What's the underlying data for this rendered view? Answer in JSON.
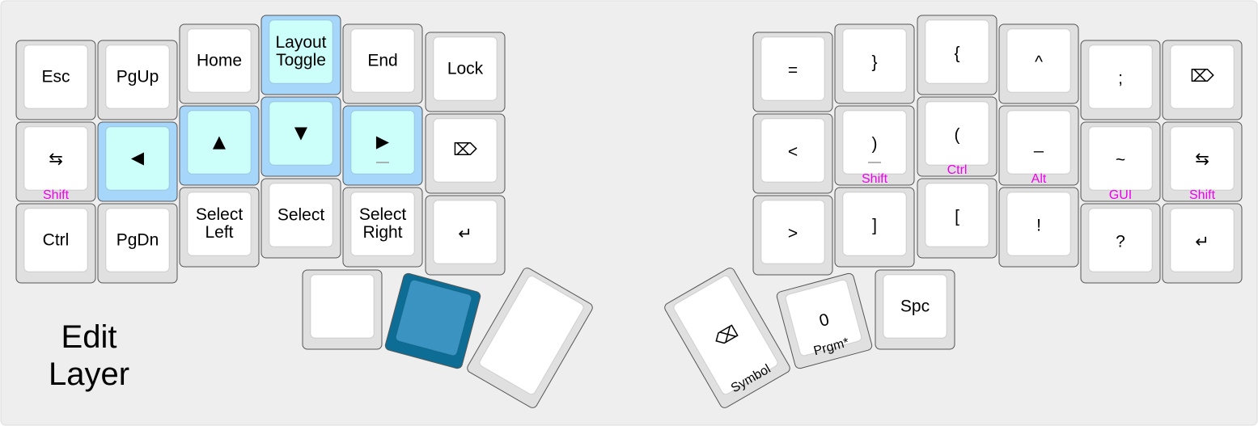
{
  "layer": {
    "title_line1": "Edit",
    "title_line2": "Layer"
  },
  "colors": {
    "board_bg": "#eeeeee",
    "key_outer": "#e0e0e0",
    "key_inner": "#ffffff",
    "key_border": "#555555",
    "highlight_outer": "#a6d7fb",
    "highlight_inner": "#ccfffa",
    "held_outer": "#0e6d95",
    "held_inner": "#3a93c0",
    "hold_text": "#ee00ee"
  },
  "keys": {
    "esc": {
      "tap": "Esc"
    },
    "pgup": {
      "tap": "PgUp"
    },
    "home": {
      "tap": "Home"
    },
    "layout_toggle": {
      "line1": "Layout",
      "line2": "Toggle"
    },
    "end": {
      "tap": "End"
    },
    "lock": {
      "tap": "Lock"
    },
    "tab_left": {
      "tap": "⇆",
      "hold": "Shift"
    },
    "arrow_left": {
      "tap": "◀"
    },
    "arrow_up": {
      "tap": "▲"
    },
    "arrow_down": {
      "tap": "▼"
    },
    "arrow_right": {
      "tap": "▶"
    },
    "delete_left": {
      "tap": "⌦"
    },
    "ctrl_left": {
      "tap": "Ctrl"
    },
    "pgdn": {
      "tap": "PgDn"
    },
    "select_left": {
      "line1": "Select",
      "line2": "Left"
    },
    "select": {
      "tap": "Select"
    },
    "select_right": {
      "line1": "Select",
      "line2": "Right"
    },
    "enter_left": {
      "tap": "↵"
    },
    "equals": {
      "tap": "="
    },
    "rbrace": {
      "tap": "}"
    },
    "lbrace": {
      "tap": "{"
    },
    "caret": {
      "tap": "^"
    },
    "semicolon": {
      "tap": ";"
    },
    "delete_right": {
      "tap": "⌦"
    },
    "less": {
      "tap": "<"
    },
    "rparen": {
      "tap": ")",
      "hold": "Shift"
    },
    "lparen": {
      "tap": "(",
      "hold": "Ctrl"
    },
    "underscore": {
      "tap": "_",
      "hold": "Alt"
    },
    "tilde": {
      "tap": "~",
      "hold": "GUI"
    },
    "tab_right": {
      "tap": "⇆",
      "hold": "Shift"
    },
    "greater": {
      "tap": ">"
    },
    "rbracket": {
      "tap": "]"
    },
    "lbracket": {
      "tap": "["
    },
    "bang": {
      "tap": "!"
    },
    "question": {
      "tap": "?"
    },
    "enter_right": {
      "tap": "↵"
    },
    "thumb_left_1": {
      "tap": ""
    },
    "thumb_left_2": {
      "tap": ""
    },
    "thumb_left_3": {
      "tap": ""
    },
    "thumb_right_1": {
      "tap": "⌫",
      "hold": "Symbol"
    },
    "thumb_right_2": {
      "tap": "0",
      "hold": "Prgm*"
    },
    "spc": {
      "tap": "Spc"
    }
  }
}
